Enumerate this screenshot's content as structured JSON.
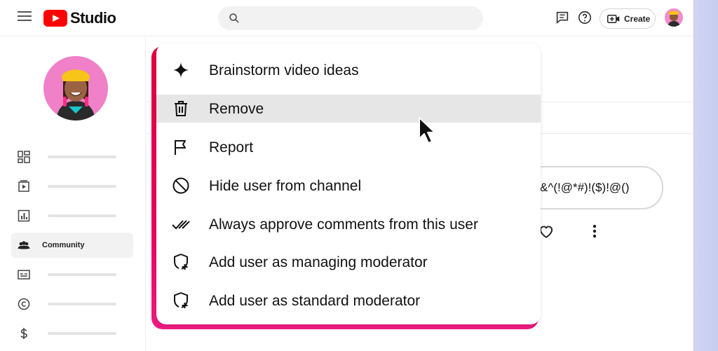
{
  "app": {
    "name": "Studio",
    "brand_color": "#ff0000"
  },
  "header": {
    "search_placeholder": "",
    "create_label": "Create",
    "icons": [
      "menu-icon",
      "search-icon",
      "feedback-icon",
      "help-icon",
      "create-video-icon"
    ]
  },
  "sidebar": {
    "items": [
      {
        "icon": "dashboard-icon",
        "label": ""
      },
      {
        "icon": "content-icon",
        "label": ""
      },
      {
        "icon": "analytics-icon",
        "label": ""
      },
      {
        "icon": "community-icon",
        "label": "Community",
        "active": true
      },
      {
        "icon": "subtitles-icon",
        "label": ""
      },
      {
        "icon": "copyright-icon",
        "label": ""
      },
      {
        "icon": "earn-icon",
        "label": ""
      }
    ]
  },
  "comment": {
    "text": "&^(!@*#)!($)!@()"
  },
  "context_menu": {
    "accent_color": "#e0003c",
    "items": [
      {
        "icon": "sparkle-icon",
        "label": "Brainstorm video ideas"
      },
      {
        "icon": "trash-icon",
        "label": "Remove",
        "hovered": true
      },
      {
        "icon": "flag-icon",
        "label": "Report"
      },
      {
        "icon": "block-icon",
        "label": "Hide user from channel"
      },
      {
        "icon": "double-check-icon",
        "label": "Always approve comments from this user"
      },
      {
        "icon": "shield-plus-icon",
        "label": "Add user as managing moderator"
      },
      {
        "icon": "shield-plus-icon",
        "label": "Add user as standard moderator"
      }
    ]
  }
}
